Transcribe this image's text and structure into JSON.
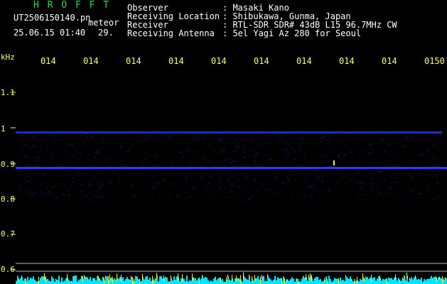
{
  "colors": {
    "background": "#000000",
    "header_text": "#ffffff",
    "title_green": "#22dd44",
    "axis_yellow": "#ffff66",
    "signal_blue": "#2a3cff",
    "noise_cyan": "#00e5ff",
    "noise_yellow": "#ffff33"
  },
  "app": {
    "title": "H R O F F T"
  },
  "file": {
    "name": "UT2506150140.pn",
    "tag": "meteor",
    "date_time": "25.06.15 01:40",
    "count": "29."
  },
  "info": [
    {
      "label": "Observer",
      "value": ": Masaki Kano"
    },
    {
      "label": "Receiving Location",
      "value": ": Shibukawa, Gunma, Japan"
    },
    {
      "label": "Receiver",
      "value": ": RTL-SDR SDR# 43dB L15 96.7MHz CW"
    },
    {
      "label": "Receiving Antenna",
      "value": ": 5el Yagi Az 280 for Seoul"
    }
  ],
  "axis": {
    "unit": "kHz",
    "freq_ticks": [
      "1.1",
      "1",
      "0.9",
      "0.8",
      "0.7",
      "0.6"
    ],
    "time_ticks": [
      "014",
      "014",
      "014",
      "014",
      "014",
      "014",
      "014",
      "014",
      "014",
      "0150"
    ]
  },
  "spectrogram": {
    "freq_range_khz": [
      0.6,
      1.1
    ],
    "lines_khz": [
      {
        "freq": 0.985,
        "strength": "weak"
      },
      {
        "freq": 0.89,
        "strength": "strong"
      }
    ],
    "noise_band_khz": [
      0.8,
      0.99
    ]
  }
}
